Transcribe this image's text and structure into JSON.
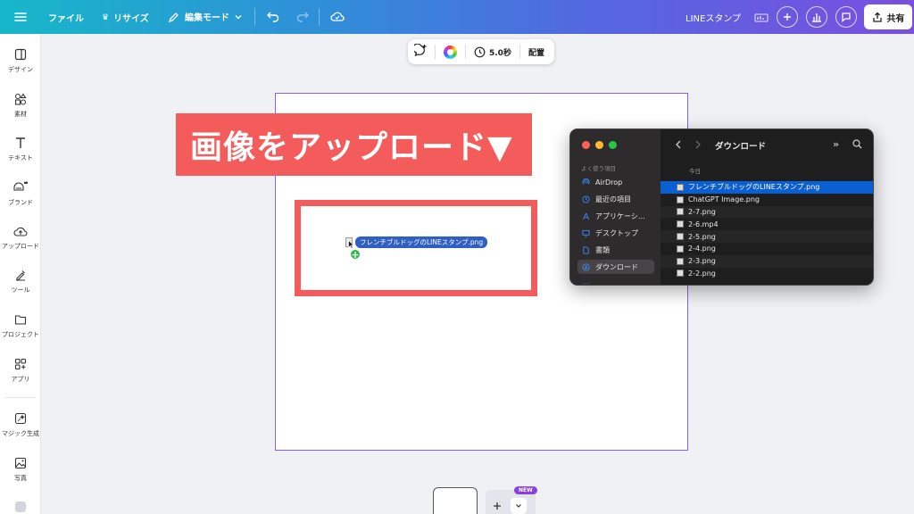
{
  "topbar": {
    "file": "ファイル",
    "resize": "リサイズ",
    "edit_mode": "編集モード",
    "title": "LINEスタンプ",
    "share": "共有"
  },
  "sidebar": {
    "items": [
      {
        "label": "デザイン",
        "icon": "design-icon"
      },
      {
        "label": "素材",
        "icon": "elements-icon"
      },
      {
        "label": "テキスト",
        "icon": "text-icon"
      },
      {
        "label": "ブランド",
        "icon": "brand-icon"
      },
      {
        "label": "アップロード",
        "icon": "upload-icon"
      },
      {
        "label": "ツール",
        "icon": "tools-icon"
      },
      {
        "label": "プロジェクト",
        "icon": "folder-icon"
      },
      {
        "label": "アプリ",
        "icon": "apps-icon"
      },
      {
        "label": "マジック生成",
        "icon": "magic-icon"
      },
      {
        "label": "写真",
        "icon": "photo-icon"
      }
    ]
  },
  "float_bar": {
    "duration": "5.0秒",
    "arrange": "配置"
  },
  "canvas": {
    "banner": "画像をアップロード▼",
    "dragged_file": "フレンチブルドッグのLINEスタンプ.png"
  },
  "finder": {
    "section": "よく使う項目",
    "sidebar": [
      {
        "label": "AirDrop",
        "icon": "airdrop-icon"
      },
      {
        "label": "最近の項目",
        "icon": "clock-icon"
      },
      {
        "label": "アプリケーシ…",
        "icon": "apps-icon"
      },
      {
        "label": "デスクトップ",
        "icon": "desktop-icon"
      },
      {
        "label": "書類",
        "icon": "document-icon"
      },
      {
        "label": "ダウンロード",
        "icon": "download-icon"
      }
    ],
    "title": "ダウンロード",
    "group": "今日",
    "files": [
      "フレンチブルドッグのLINEスタンプ.png",
      "ChatGPT Image.png",
      "2-7.png",
      "2-6.mp4",
      "2-5.png",
      "2-4.png",
      "2-3.png",
      "2-2.png"
    ]
  },
  "pages": {
    "new_badge": "NEW"
  },
  "colors": {
    "accent_red": "#f45b5b",
    "selection_blue": "#0a5fd3",
    "page_border": "#8b5cf6"
  }
}
